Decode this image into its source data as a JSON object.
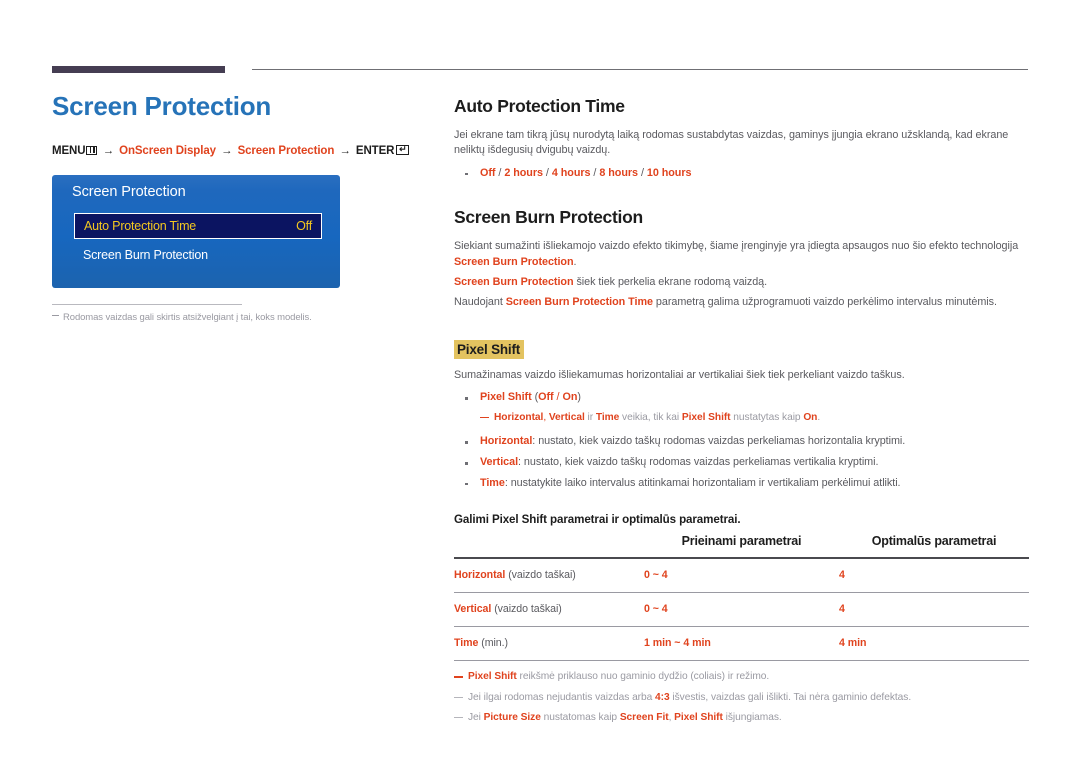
{
  "page": {
    "title": "Screen Protection",
    "title_color": "#2673b8",
    "accent_color": "#e0431e",
    "highlight_color": "#e3c360",
    "rule_color": "#453d52"
  },
  "breadcrumb": {
    "menu_label": "MENU",
    "menu_icon": "menu-bars-icon",
    "arrow": "→",
    "item1": "OnScreen Display",
    "item2": "Screen Protection",
    "enter_label": "ENTER",
    "enter_icon": "enter-key-icon",
    "enter_glyph": "↵"
  },
  "osd": {
    "title": "Screen Protection",
    "rows": [
      {
        "label": "Auto Protection Time",
        "value": "Off",
        "selected": true
      },
      {
        "label": "Screen Burn Protection",
        "value": "",
        "selected": false
      }
    ]
  },
  "left_note": "Rodomas vaizdas gali skirtis atsižvelgiant į tai, koks modelis.",
  "sections": {
    "auto_protection": {
      "heading": "Auto Protection Time",
      "body": "Jei ekrane tam tikrą jūsų nurodytą laiką rodomas sustabdytas vaizdas, gaminys įjungia ekrano užsklandą, kad ekrane neliktų išdegusių dvigubų vaizdų.",
      "options": "Off / 2 hours / 4 hours / 8 hours / 10 hours",
      "options_parts": {
        "off": "Off",
        "two": "2 hours",
        "four": "4 hours",
        "eight": "8 hours",
        "ten": "10 hours"
      }
    },
    "screen_burn": {
      "heading": "Screen Burn Protection",
      "p1_pre": "Siekiant sumažinti išliekamojo vaizdo efekto tikimybę, šiame įrenginyje yra įdiegta apsaugos nuo šio efekto technologija ",
      "p1_accent": "Screen Burn Protection",
      "p1_post": ".",
      "p2_accent": "Screen Burn Protection",
      "p2_post": " šiek tiek perkelia ekrane rodomą vaizdą.",
      "p3_pre": "Naudojant ",
      "p3_accent": "Screen Burn Protection Time",
      "p3_post": " parametrą galima užprogramuoti vaizdo perkėlimo intervalus minutėmis."
    },
    "pixel_shift": {
      "heading": "Pixel Shift",
      "body": "Sumažinamas vaizdo išliekamumas horizontaliai ar vertikaliai šiek tiek perkeliant vaizdo taškus.",
      "bullet_main": {
        "name": "Pixel Shift",
        "values": "(Off / On)",
        "value_off": "Off",
        "value_sep": " / ",
        "value_on": "On"
      },
      "subnote": {
        "a": "Horizontal",
        "sep1": ", ",
        "b": "Vertical",
        "sep2": " ir ",
        "c": "Time",
        "mid": " veikia, tik kai ",
        "d": "Pixel Shift",
        "tail": " nustatytas kaip ",
        "e": "On",
        "end": "."
      },
      "bullets": [
        {
          "name": "Horizontal",
          "text": ": nustato, kiek vaizdo taškų rodomas vaizdas perkeliamas horizontalia kryptimi."
        },
        {
          "name": "Vertical",
          "text": ": nustato, kiek vaizdo taškų rodomas vaizdas perkeliamas vertikalia kryptimi."
        },
        {
          "name": "Time",
          "text": ": nustatykite laiko intervalus atitinkamai horizontaliam ir vertikaliam perkėlimui atlikti."
        }
      ]
    }
  },
  "table": {
    "caption": "Galimi Pixel Shift parametrai ir optimalūs parametrai.",
    "headers": [
      "",
      "Prieinami parametrai",
      "Optimalūs parametrai"
    ],
    "rows": [
      {
        "label": "Horizontal",
        "unit": " (vaizdo taškai)",
        "available": "0 ~ 4",
        "optimal": "4"
      },
      {
        "label": "Vertical",
        "unit": " (vaizdo taškai)",
        "available": "0 ~ 4",
        "optimal": "4"
      },
      {
        "label": "Time",
        "unit": " (min.)",
        "available": "1 min ~ 4 min",
        "optimal": "4 min"
      }
    ]
  },
  "footnotes": [
    {
      "a": "Pixel Shift",
      "text": " reikšmė priklauso nuo gaminio dydžio (coliais) ir režimo.",
      "b": "",
      "text2": "",
      "style": "accent"
    },
    {
      "a": "Jei ilgai rodomas nejudantis vaizdas arba ",
      "text": "4:3",
      "b": " išvestis, vaizdas gali išlikti. Tai nėra gaminio defektas.",
      "text2": "",
      "style": "grey"
    },
    {
      "a": "Jei ",
      "text": "Picture Size",
      "b": " nustatomas kaip ",
      "text2": "Screen Fit",
      "c": ", ",
      "d": "Pixel Shift",
      "e": " išjungiamas.",
      "style": "grey"
    }
  ]
}
